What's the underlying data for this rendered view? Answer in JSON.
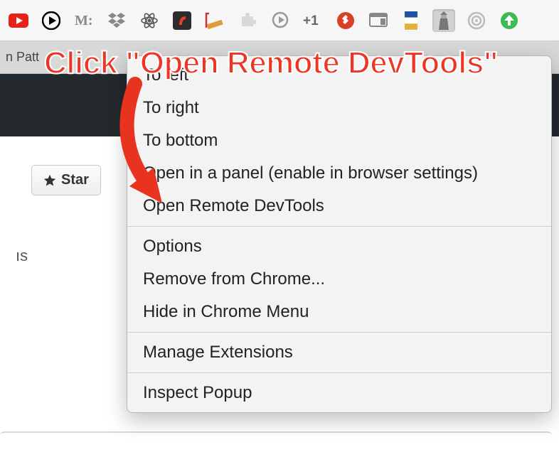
{
  "toolbar": {
    "icons": [
      "youtube-icon",
      "play-icon",
      "m-icon",
      "dropbox-icon",
      "react-icon",
      "flash-icon",
      "ruler-icon",
      "puzzle-icon",
      "speech-icon",
      "plusone-icon",
      "plug-icon",
      "window-icon",
      "flag-icon",
      "lighthouse-icon",
      "target-icon",
      "upload-icon"
    ]
  },
  "tab": {
    "prefix": "n Patt"
  },
  "star": {
    "label": "Star"
  },
  "paths": {
    "label": "ıs"
  },
  "menu": {
    "group1": [
      {
        "label": "To left"
      },
      {
        "label": "To right"
      },
      {
        "label": "To bottom"
      },
      {
        "label": "Open in a panel (enable in browser settings)"
      },
      {
        "label": "Open Remote DevTools"
      }
    ],
    "group2": [
      {
        "label": "Options"
      },
      {
        "label": "Remove from Chrome..."
      },
      {
        "label": "Hide in Chrome Menu"
      }
    ],
    "group3": [
      {
        "label": "Manage Extensions"
      }
    ],
    "group4": [
      {
        "label": "Inspect Popup"
      }
    ]
  },
  "annotation": {
    "text": "Click \"Open Remote DevTools\""
  }
}
